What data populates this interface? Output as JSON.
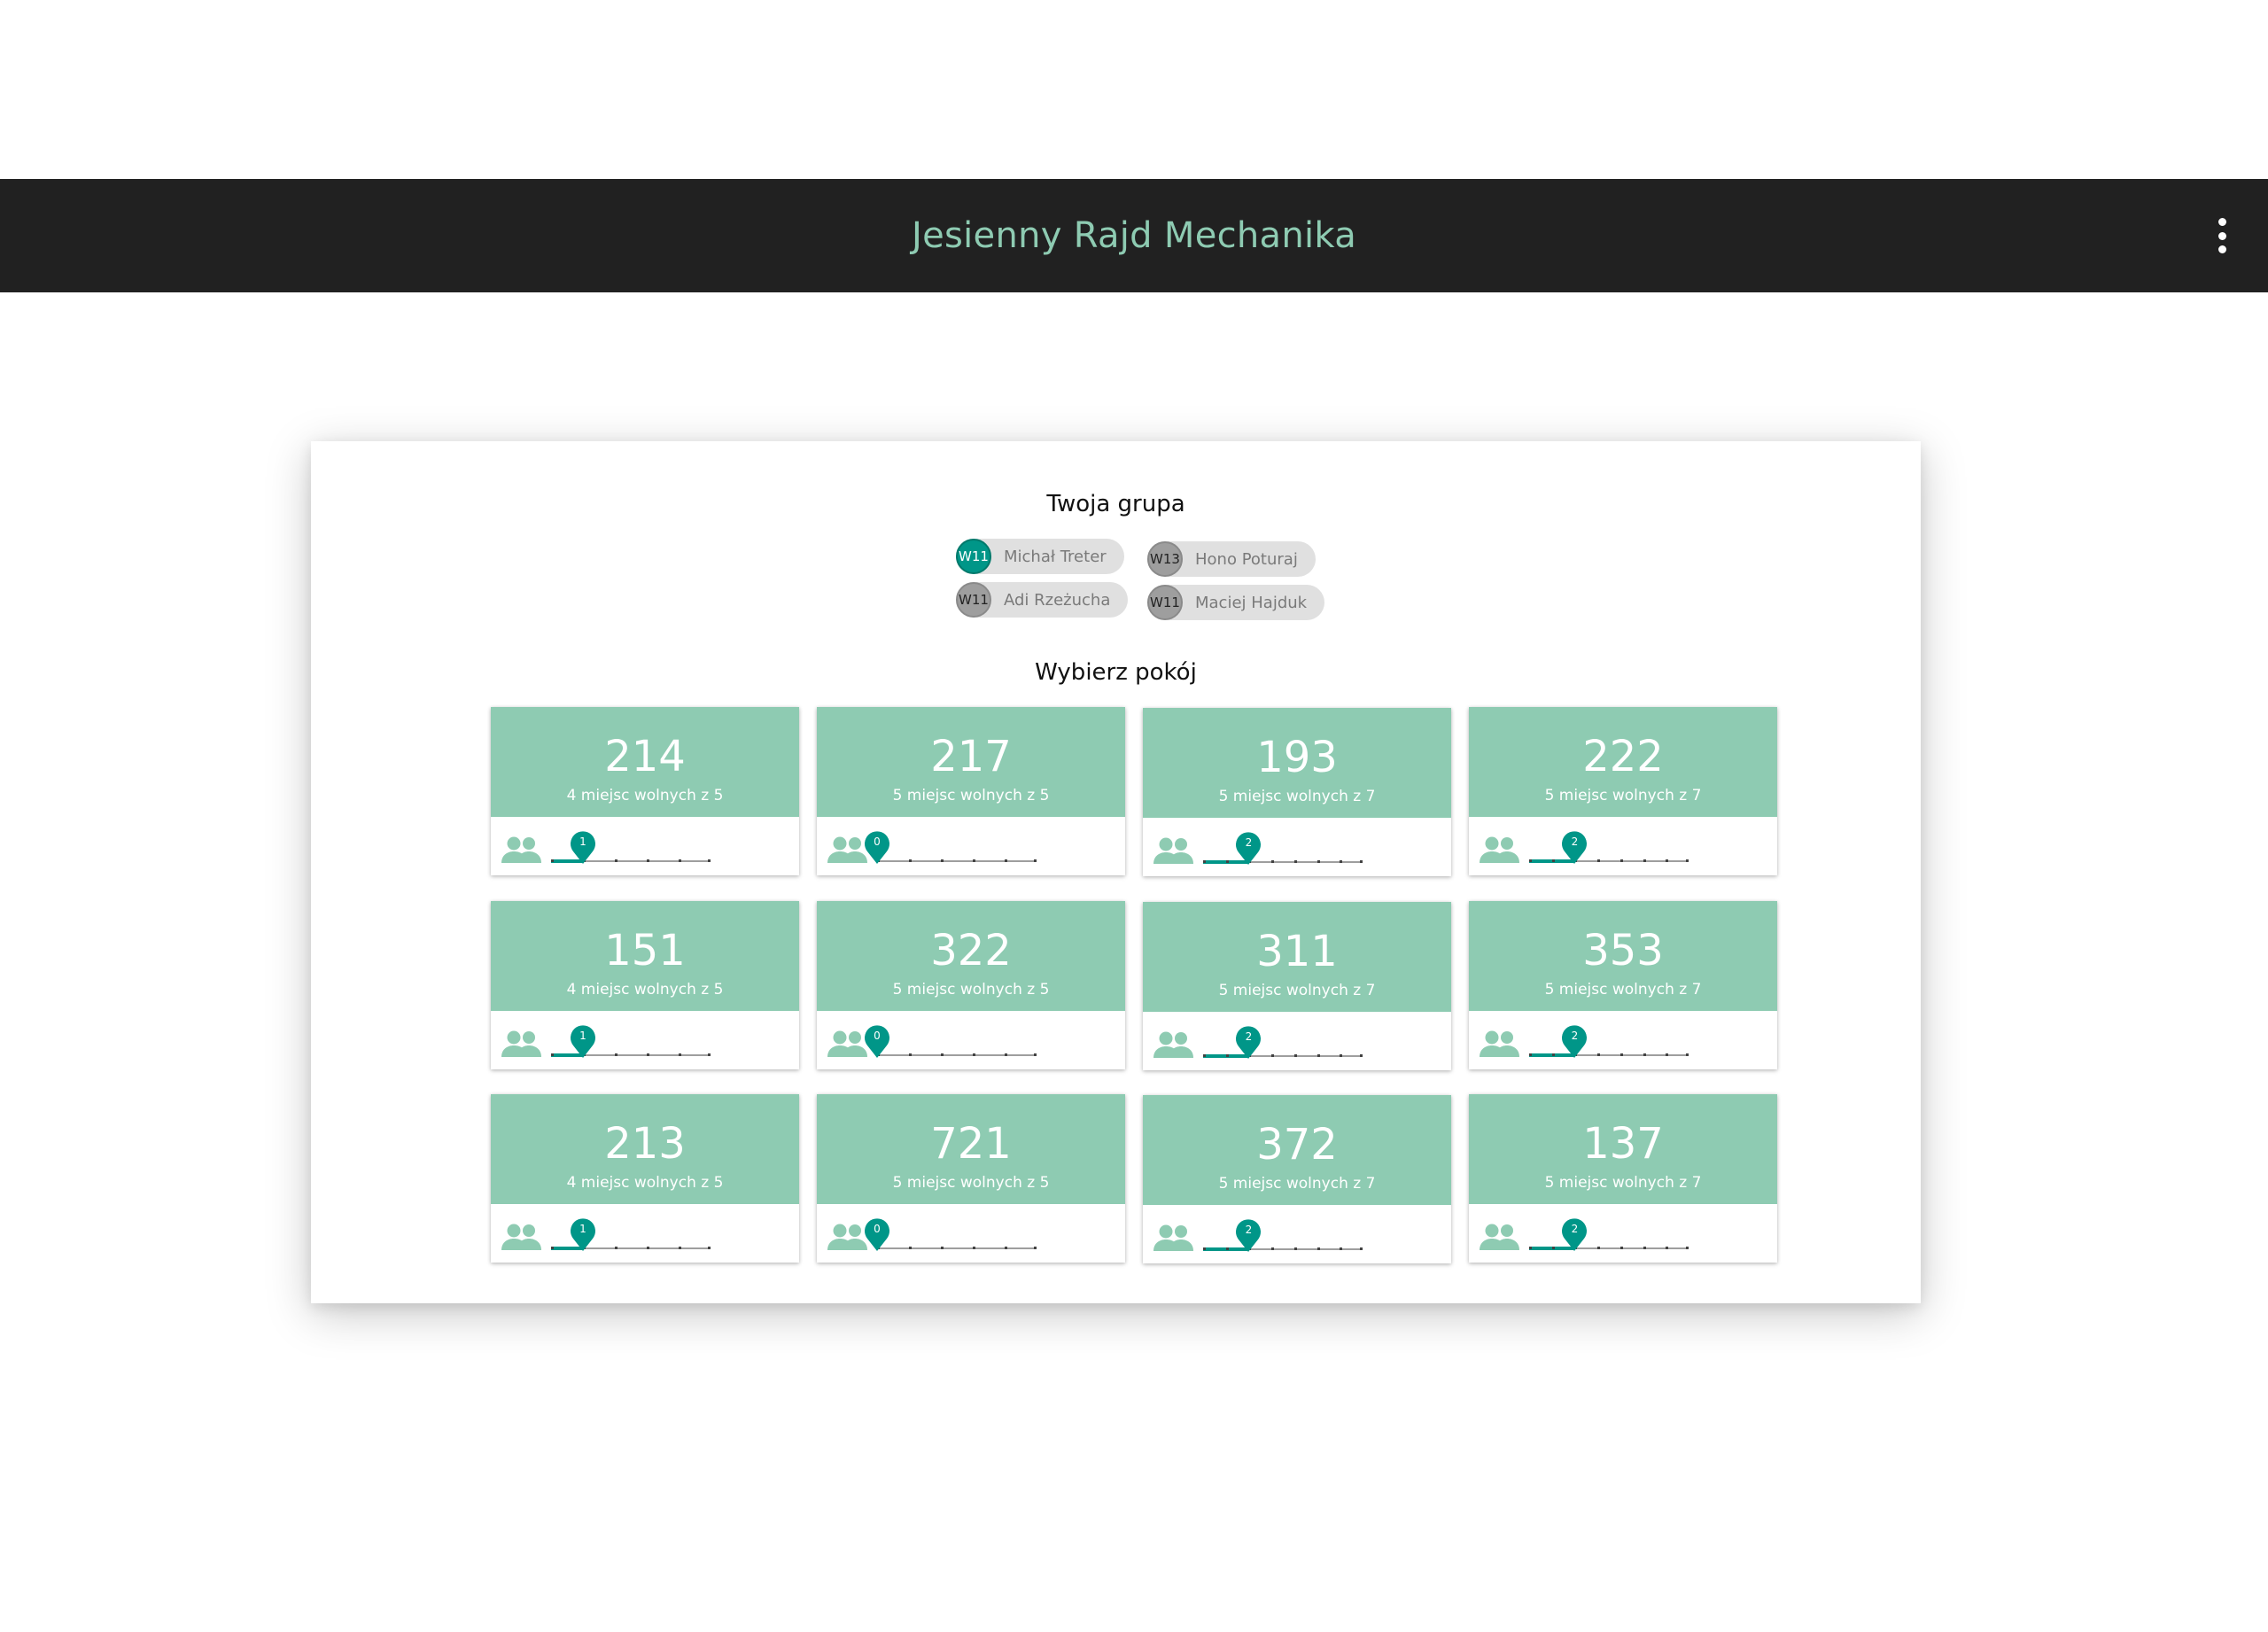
{
  "header": {
    "title": "Jesienny Rajd Mechanika",
    "menu_icon": "more-vert-icon"
  },
  "group": {
    "title": "Twoja grupa",
    "members": [
      {
        "badge": "W11",
        "name": "Michał Treter",
        "active": true
      },
      {
        "badge": "W11",
        "name": "Adi Rzeżucha",
        "active": false
      },
      {
        "badge": "W13",
        "name": "Hono Poturaj",
        "active": false
      },
      {
        "badge": "W11",
        "name": "Maciej Hajduk",
        "active": false
      }
    ]
  },
  "rooms": {
    "title": "Wybierz pokój",
    "items": [
      {
        "number": "214",
        "free_text": "4 miejsc wolnych z 5",
        "occupied": 1,
        "capacity": 5
      },
      {
        "number": "217",
        "free_text": "5 miejsc wolnych z 5",
        "occupied": 0,
        "capacity": 5
      },
      {
        "number": "193",
        "free_text": "5 miejsc wolnych z 7",
        "occupied": 2,
        "capacity": 7
      },
      {
        "number": "222",
        "free_text": "5 miejsc wolnych z 7",
        "occupied": 2,
        "capacity": 7
      },
      {
        "number": "151",
        "free_text": "4 miejsc wolnych z 5",
        "occupied": 1,
        "capacity": 5
      },
      {
        "number": "322",
        "free_text": "5 miejsc wolnych z 5",
        "occupied": 0,
        "capacity": 5
      },
      {
        "number": "311",
        "free_text": "5 miejsc wolnych z 7",
        "occupied": 2,
        "capacity": 7
      },
      {
        "number": "353",
        "free_text": "5 miejsc wolnych z 7",
        "occupied": 2,
        "capacity": 7
      },
      {
        "number": "213",
        "free_text": "4 miejsc wolnych z 5",
        "occupied": 1,
        "capacity": 5
      },
      {
        "number": "721",
        "free_text": "5 miejsc wolnych z 5",
        "occupied": 0,
        "capacity": 5
      },
      {
        "number": "372",
        "free_text": "5 miejsc wolnych z 7",
        "occupied": 2,
        "capacity": 7
      },
      {
        "number": "137",
        "free_text": "5 miejsc wolnych z 7",
        "occupied": 2,
        "capacity": 7
      }
    ]
  },
  "colors": {
    "accent": "#009688",
    "card_header": "#8ecbb2",
    "title_text": "#8ecbb2",
    "app_bar": "#212121"
  }
}
